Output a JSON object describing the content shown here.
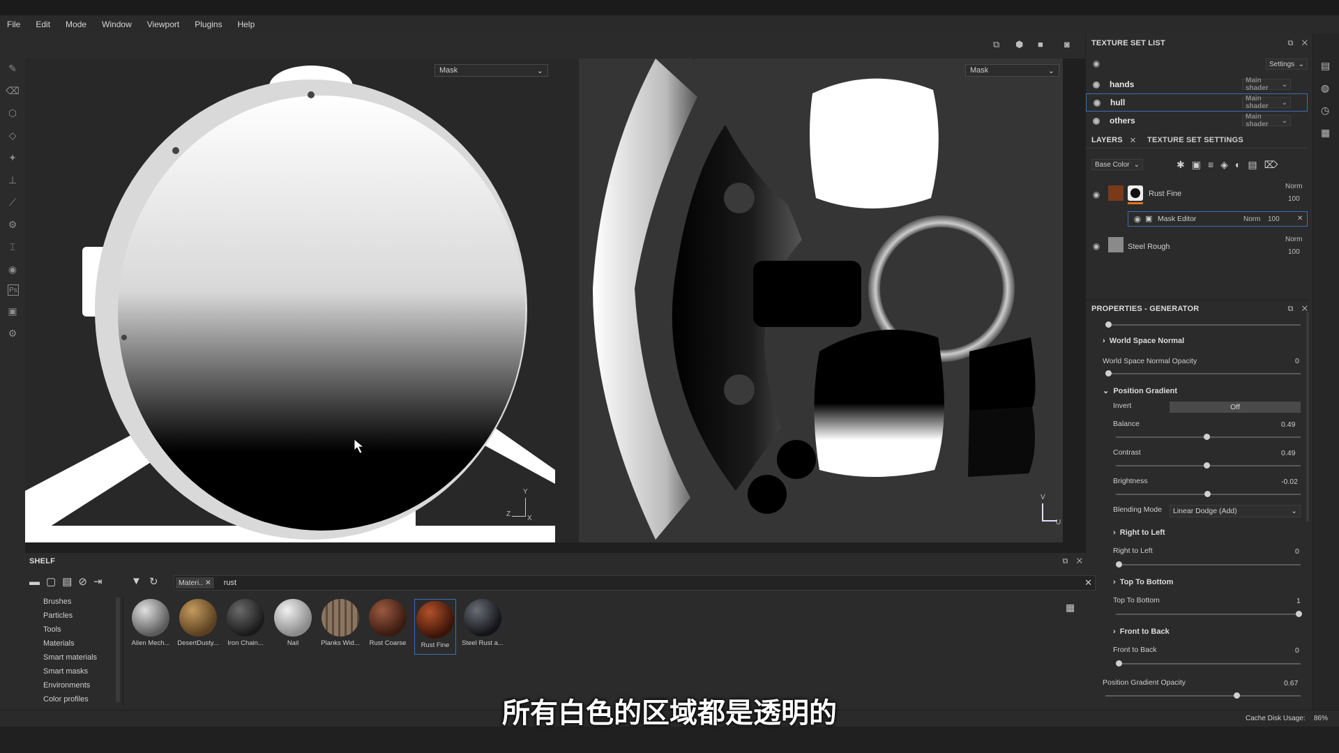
{
  "menu": [
    "File",
    "Edit",
    "Mode",
    "Window",
    "Viewport",
    "Plugins",
    "Help"
  ],
  "viewport": {
    "left_channel": "Mask",
    "right_channel": "Mask",
    "axis_3d": {
      "y": "Y",
      "z": "Z",
      "x": "X"
    },
    "axis_2d": {
      "v": "V",
      "u": "U"
    }
  },
  "texture_set_list": {
    "title": "TEXTURE SET LIST",
    "settings_label": "Settings",
    "sets": [
      {
        "name": "hands",
        "shader": "Main shader"
      },
      {
        "name": "hull",
        "shader": "Main shader",
        "selected": true
      },
      {
        "name": "others",
        "shader": "Main shader"
      }
    ]
  },
  "layers": {
    "tab_layers": "LAYERS",
    "tab_settings": "TEXTURE SET SETTINGS",
    "channel": "Base Color",
    "items": [
      {
        "name": "Rust Fine",
        "blend": "Norm",
        "opacity": "100"
      },
      {
        "name": "Mask Editor",
        "blend": "Norm",
        "opacity": "100"
      },
      {
        "name": "Steel Rough",
        "blend": "Norm",
        "opacity": "100"
      }
    ]
  },
  "properties": {
    "title": "PROPERTIES - GENERATOR",
    "world_space_normal": "World Space Normal",
    "world_space_normal_opacity_label": "World Space Normal Opacity",
    "world_space_normal_opacity": "0",
    "position_gradient": "Position Gradient",
    "invert_label": "Invert",
    "invert_value": "Off",
    "balance_label": "Balance",
    "balance": "0.49",
    "contrast_label": "Contrast",
    "contrast": "0.49",
    "brightness_label": "Brightness",
    "brightness": "-0.02",
    "blending_mode_label": "Blending Mode",
    "blending_mode": "Linear Dodge (Add)",
    "right_to_left_section": "Right to Left",
    "right_to_left_label": "Right to Left",
    "right_to_left": "0",
    "top_to_bottom_section": "Top To Bottom",
    "top_to_bottom_label": "Top To Bottom",
    "top_to_bottom": "1",
    "front_to_back_section": "Front to Back",
    "front_to_back_label": "Front to Back",
    "front_to_back": "0",
    "opacity_label": "Position Gradient Opacity",
    "opacity": "0.67"
  },
  "shelf": {
    "title": "SHELF",
    "filter_tag": "Materi..",
    "search": "rust",
    "categories": [
      "Brushes",
      "Particles",
      "Tools",
      "Materials",
      "Smart materials",
      "Smart masks",
      "Environments",
      "Color profiles"
    ],
    "items": [
      {
        "name": "Alien Mech...",
        "color": "#8a8a8a"
      },
      {
        "name": "DesertDusty...",
        "color": "#8d6a3c"
      },
      {
        "name": "Iron Chain...",
        "color": "#3a3a3a"
      },
      {
        "name": "Nail",
        "color": "#b8b8b8"
      },
      {
        "name": "Planks Wid...",
        "color": "#6e5a48"
      },
      {
        "name": "Rust Coarse",
        "color": "#6a3a28"
      },
      {
        "name": "Rust Fine",
        "color": "#7a3018",
        "selected": true
      },
      {
        "name": "Steel Rust a...",
        "color": "#2c2e33"
      }
    ]
  },
  "status": {
    "cache_label": "Cache Disk Usage:",
    "cache_value": "86%"
  },
  "subtitle": "所有白色的区域都是透明的"
}
